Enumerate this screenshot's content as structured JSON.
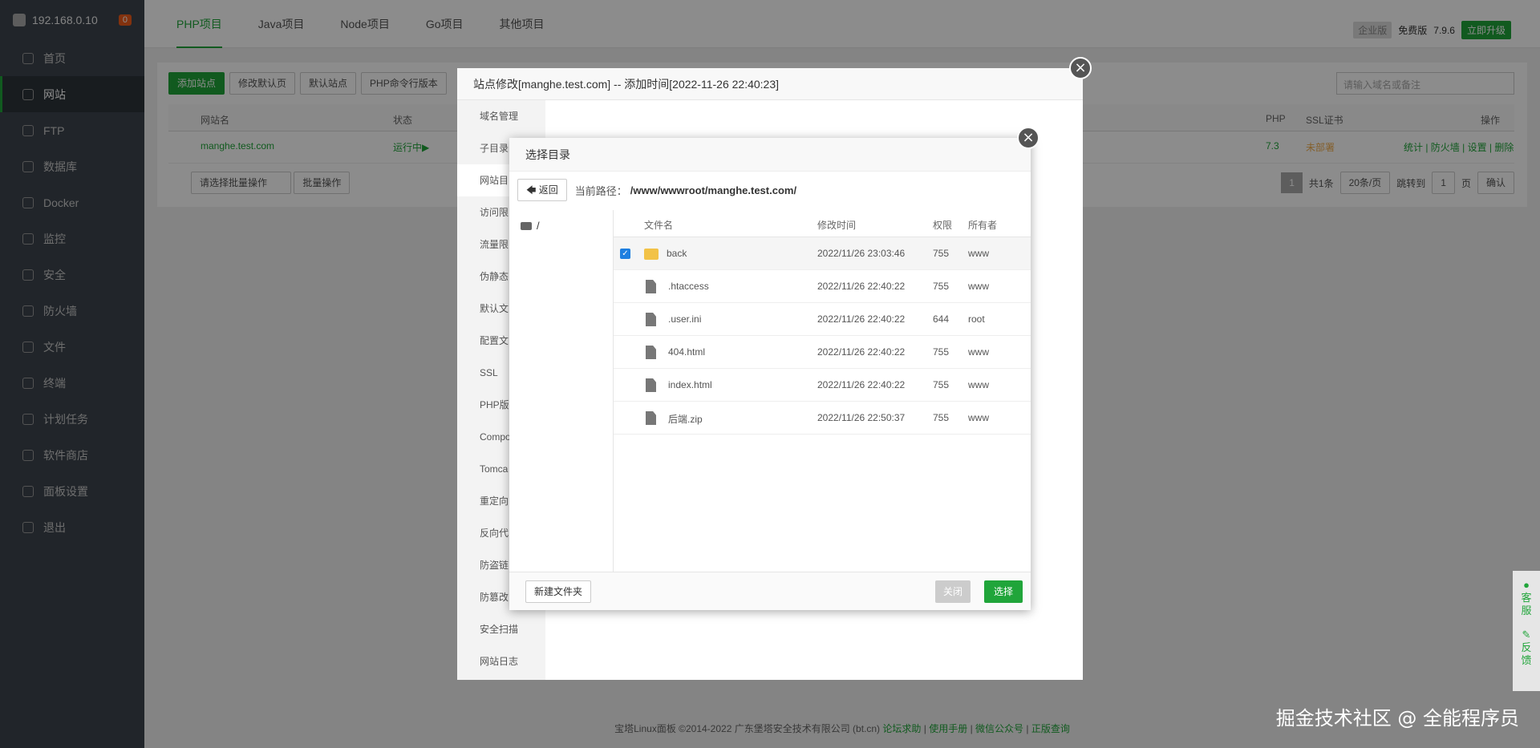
{
  "sidebar": {
    "ip": "192.168.0.10",
    "badge": "0",
    "items": [
      "首页",
      "网站",
      "FTP",
      "数据库",
      "Docker",
      "监控",
      "安全",
      "防火墙",
      "文件",
      "终端",
      "计划任务",
      "软件商店",
      "面板设置",
      "退出"
    ]
  },
  "topbar": {
    "tabs": [
      "PHP项目",
      "Java项目",
      "Node项目",
      "Go项目",
      "其他项目"
    ],
    "enterprise": "企业版",
    "free": "免费版",
    "version": "7.9.6",
    "upgrade": "立即升级"
  },
  "toolbar": {
    "buttons": [
      "添加站点",
      "修改默认页",
      "默认站点",
      "PHP命令行版本"
    ],
    "search_placeholder": "请输入域名或备注"
  },
  "table": {
    "headers": [
      "网站名",
      "状态",
      "PHP",
      "SSL证书",
      "操作"
    ],
    "row": {
      "site": "manghe.test.com",
      "status": "运行中▶",
      "php": "7.3",
      "ssl": "未部署",
      "actions": "统计 | 防火墙 | 设置 | 删除"
    },
    "batch_select": "请选择批量操作",
    "batch_btn": "批量操作",
    "page": "1",
    "total": "共1条",
    "per_page": "20条/页",
    "goto": "跳转到",
    "goto_page": "1",
    "page_unit": "页",
    "confirm": "确认"
  },
  "outer_dialog": {
    "title": "站点修改[manghe.test.com] -- 添加时间[2022-11-26 22:40:23]",
    "menu": [
      "域名管理",
      "子目录",
      "网站目",
      "访问限",
      "流量限",
      "伪静态",
      "默认文",
      "配置文",
      "SSL",
      "PHP版",
      "Compo",
      "Tomca",
      "重定向",
      "反向代",
      "防盗链",
      "防篡改",
      "安全扫描",
      "网站日志"
    ]
  },
  "dialog": {
    "title": "选择目录",
    "back": "返回",
    "path_label": "当前路径：",
    "path": "/www/wwwroot/manghe.test.com/",
    "tree_root": "/",
    "columns": [
      "文件名",
      "修改时间",
      "权限",
      "所有者"
    ],
    "files": [
      {
        "name": "back",
        "time": "2022/11/26 23:03:46",
        "perm": "755",
        "owner": "www",
        "type": "folder",
        "checked": true
      },
      {
        "name": ".htaccess",
        "time": "2022/11/26 22:40:22",
        "perm": "755",
        "owner": "www",
        "type": "file"
      },
      {
        "name": ".user.ini",
        "time": "2022/11/26 22:40:22",
        "perm": "644",
        "owner": "root",
        "type": "file"
      },
      {
        "name": "404.html",
        "time": "2022/11/26 22:40:22",
        "perm": "755",
        "owner": "www",
        "type": "file"
      },
      {
        "name": "index.html",
        "time": "2022/11/26 22:40:22",
        "perm": "755",
        "owner": "www",
        "type": "file"
      },
      {
        "name": "后端.zip",
        "time": "2022/11/26 22:50:37",
        "perm": "755",
        "owner": "www",
        "type": "file"
      }
    ],
    "new_folder": "新建文件夹",
    "close": "关闭",
    "select": "选择"
  },
  "footer": {
    "copyright": "宝塔Linux面板 ©2014-2022 广东堡塔安全技术有限公司 (bt.cn)",
    "links": [
      "论坛求助",
      "使用手册",
      "微信公众号",
      "正版查询"
    ]
  },
  "kefu": [
    "客",
    "服",
    "反",
    "馈"
  ],
  "watermark": "掘金技术社区 @ 全能程序员"
}
